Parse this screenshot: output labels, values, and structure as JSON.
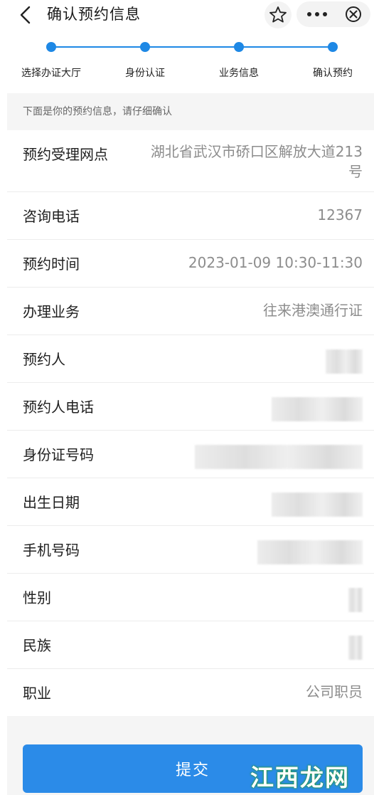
{
  "navbar": {
    "title": "确认预约信息",
    "back_icon": "chevron-left-icon",
    "star_icon": "star-outline-icon",
    "more_icon": "more-dots-icon",
    "close_icon": "circle-close-icon"
  },
  "steps": [
    {
      "label": "选择办证大厅"
    },
    {
      "label": "身份认证"
    },
    {
      "label": "业务信息"
    },
    {
      "label": "确认预约"
    }
  ],
  "notice": "下面是你的预约信息，请仔细确认",
  "rows": [
    {
      "label": "预约受理网点",
      "value": "湖北省武汉市硚口区解放大道213号"
    },
    {
      "label": "咨询电话",
      "value": "12367"
    },
    {
      "label": "预约时间",
      "value": "2023-01-09 10:30-11:30"
    },
    {
      "label": "办理业务",
      "value": "往来港澳通行证"
    },
    {
      "label": "预约人",
      "value": ""
    },
    {
      "label": "预约人电话",
      "value": ""
    },
    {
      "label": "身份证号码",
      "value": ""
    },
    {
      "label": "出生日期",
      "value": ""
    },
    {
      "label": "手机号码",
      "value": ""
    },
    {
      "label": "性别",
      "value": ""
    },
    {
      "label": "民族",
      "value": ""
    },
    {
      "label": "职业",
      "value": "公司职员"
    }
  ],
  "submit_label": "提交",
  "watermark": {
    "text": "江西龙网"
  },
  "colors": {
    "accent": "#1e88e5",
    "button": "#2b8be8",
    "value_text": "#8d8d8d"
  }
}
